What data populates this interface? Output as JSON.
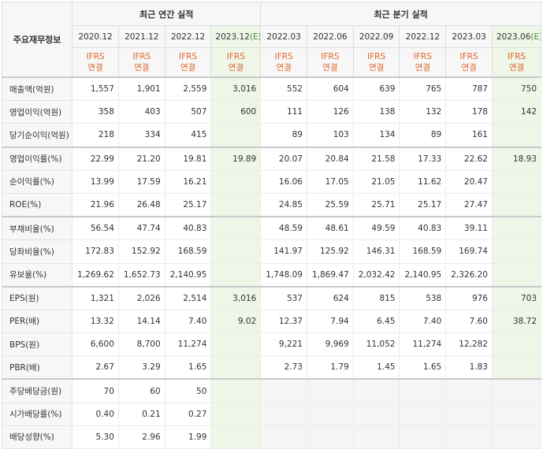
{
  "header": {
    "corner_label": "주요재무정보",
    "annual_group": "최근 연간 실적",
    "quarter_group": "최근 분기 실적",
    "annual_periods": [
      "2020.12",
      "2021.12",
      "2022.12",
      "2023.12(E)"
    ],
    "quarter_periods": [
      "2022.03",
      "2022.06",
      "2022.09",
      "2022.12",
      "2023.03",
      "2023.06(E)"
    ],
    "accounting_line1": "IFRS",
    "accounting_line2": "연결"
  },
  "rows": [
    {
      "label": "매출액(억원)",
      "annual": [
        "1,557",
        "1,901",
        "2,559",
        "3,016"
      ],
      "quarter": [
        "552",
        "604",
        "639",
        "765",
        "787",
        "750"
      ]
    },
    {
      "label": "영업이익(억원)",
      "annual": [
        "358",
        "403",
        "507",
        "600"
      ],
      "quarter": [
        "111",
        "126",
        "138",
        "132",
        "178",
        "142"
      ]
    },
    {
      "label": "당기순이익(억원)",
      "annual": [
        "218",
        "334",
        "415",
        ""
      ],
      "quarter": [
        "89",
        "103",
        "134",
        "89",
        "161",
        ""
      ]
    },
    {
      "label": "영업이익률(%)",
      "annual": [
        "22.99",
        "21.20",
        "19.81",
        "19.89"
      ],
      "quarter": [
        "20.07",
        "20.84",
        "21.58",
        "17.33",
        "22.62",
        "18.93"
      ]
    },
    {
      "label": "순이익률(%)",
      "annual": [
        "13.99",
        "17.59",
        "16.21",
        ""
      ],
      "quarter": [
        "16.06",
        "17.05",
        "21.05",
        "11.62",
        "20.47",
        ""
      ]
    },
    {
      "label": "ROE(%)",
      "annual": [
        "21.96",
        "26.48",
        "25.17",
        ""
      ],
      "quarter": [
        "24.85",
        "25.59",
        "25.71",
        "25.17",
        "27.47",
        ""
      ]
    },
    {
      "label": "부채비율(%)",
      "annual": [
        "56.54",
        "47.74",
        "40.83",
        ""
      ],
      "quarter": [
        "48.59",
        "48.61",
        "49.59",
        "40.83",
        "39.11",
        ""
      ]
    },
    {
      "label": "당좌비율(%)",
      "annual": [
        "172.83",
        "152.92",
        "168.59",
        ""
      ],
      "quarter": [
        "141.97",
        "125.92",
        "146.31",
        "168.59",
        "169.74",
        ""
      ]
    },
    {
      "label": "유보율(%)",
      "annual": [
        "1,269.62",
        "1,652.73",
        "2,140.95",
        ""
      ],
      "quarter": [
        "1,748.09",
        "1,869.47",
        "2,032.42",
        "2,140.95",
        "2,326.20",
        ""
      ]
    },
    {
      "label": "EPS(원)",
      "annual": [
        "1,321",
        "2,026",
        "2,514",
        "3,016"
      ],
      "quarter": [
        "537",
        "624",
        "815",
        "538",
        "976",
        "703"
      ]
    },
    {
      "label": "PER(배)",
      "annual": [
        "13.32",
        "14.14",
        "7.40",
        "9.02"
      ],
      "quarter": [
        "12.37",
        "7.94",
        "6.45",
        "7.40",
        "7.60",
        "38.72"
      ]
    },
    {
      "label": "BPS(원)",
      "annual": [
        "6,600",
        "8,700",
        "11,274",
        ""
      ],
      "quarter": [
        "9,221",
        "9,969",
        "11,052",
        "11,274",
        "12,282",
        ""
      ]
    },
    {
      "label": "PBR(배)",
      "annual": [
        "2.67",
        "3.29",
        "1.65",
        ""
      ],
      "quarter": [
        "2.73",
        "1.79",
        "1.45",
        "1.65",
        "1.83",
        ""
      ]
    },
    {
      "label": "주당배당금(원)",
      "annual": [
        "70",
        "60",
        "50",
        ""
      ],
      "quarter": [
        "",
        "",
        "",
        "",
        "",
        ""
      ]
    },
    {
      "label": "시가배당률(%)",
      "annual": [
        "0.40",
        "0.21",
        "0.27",
        ""
      ],
      "quarter": [
        "",
        "",
        "",
        "",
        "",
        ""
      ]
    },
    {
      "label": "배당성향(%)",
      "annual": [
        "5.30",
        "2.96",
        "1.99",
        ""
      ],
      "quarter": [
        "",
        "",
        "",
        "",
        "",
        ""
      ]
    }
  ]
}
